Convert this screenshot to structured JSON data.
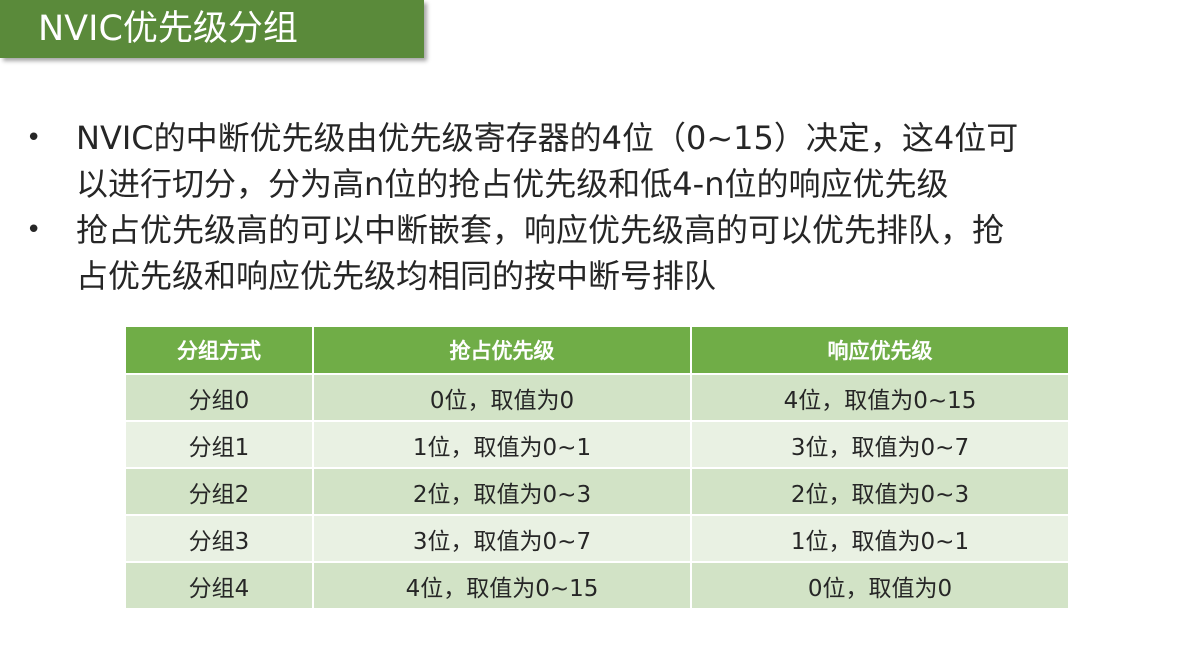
{
  "title": "NVIC优先级分组",
  "bullets": [
    {
      "lines": [
        "NVIC的中断优先级由优先级寄存器的4位（0~15）决定，这4位可",
        "以进行切分，分为高n位的抢占优先级和低4-n位的响应优先级"
      ]
    },
    {
      "lines": [
        "抢占优先级高的可以中断嵌套，响应优先级高的可以优先排队，抢",
        "占优先级和响应优先级均相同的按中断号排队"
      ]
    }
  ],
  "table": {
    "headers": [
      "分组方式",
      "抢占优先级",
      "响应优先级"
    ],
    "rows": [
      [
        "分组0",
        "0位，取值为0",
        "4位，取值为0~15"
      ],
      [
        "分组1",
        "1位，取值为0~1",
        "3位，取值为0~7"
      ],
      [
        "分组2",
        "2位，取值为0~3",
        "2位，取值为0~3"
      ],
      [
        "分组3",
        "3位，取值为0~7",
        "1位，取值为0~1"
      ],
      [
        "分组4",
        "4位，取值为0~15",
        "0位，取值为0"
      ]
    ]
  },
  "colors": {
    "title_bg": "#5a8a3a",
    "header_bg": "#70ad47",
    "row_dark": "#d2e3c6",
    "row_light": "#e9f1e3"
  }
}
